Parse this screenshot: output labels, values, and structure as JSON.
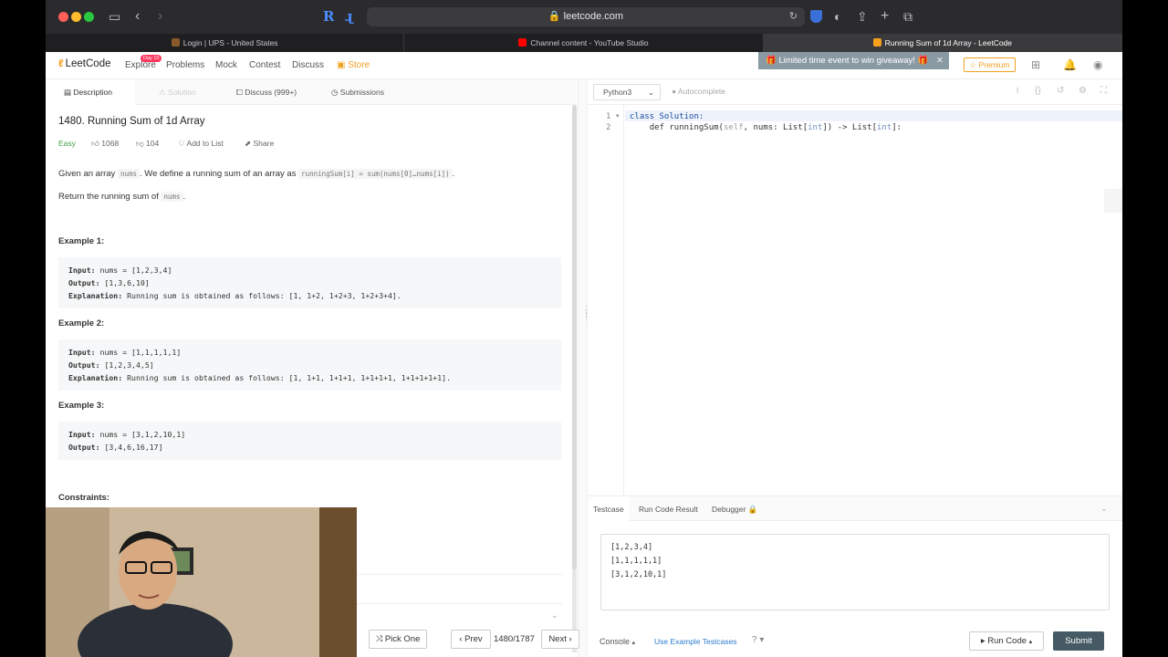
{
  "browser": {
    "url": "leetcode.com",
    "tabs": [
      {
        "title": "Login | UPS - United States",
        "active": false
      },
      {
        "title": "Channel content - YouTube Studio",
        "active": false
      },
      {
        "title": "Running Sum of 1d Array - LeetCode",
        "active": true
      }
    ]
  },
  "nav": {
    "logo": "LeetCode",
    "day_badge": "Day 10",
    "links": [
      "Explore",
      "Problems",
      "Mock",
      "Contest",
      "Discuss",
      "Store"
    ],
    "giveaway": "Limited time event to win giveaway!",
    "premium": "Premium"
  },
  "left_tabs": [
    "Description",
    "Solution",
    "Discuss (999+)",
    "Submissions"
  ],
  "problem": {
    "title": "1480. Running Sum of 1d Array",
    "difficulty": "Easy",
    "likes": "1068",
    "dislikes": "104",
    "add_to_list": "Add to List",
    "share": "Share",
    "desc_pre": "Given an array",
    "desc_code1": "nums",
    "desc_mid": ". We define a running sum of an array as",
    "desc_code2": "runningSum[i] = sum(nums[0]…nums[i])",
    "desc_end": ".",
    "return_pre": "Return the running sum of",
    "return_code": "nums",
    "return_end": ".",
    "examples": [
      {
        "heading": "Example 1:",
        "input": "nums = [1,2,3,4]",
        "output": "[1,3,6,10]",
        "explanation": "Running sum is obtained as follows: [1, 1+2, 1+2+3, 1+2+3+4]."
      },
      {
        "heading": "Example 2:",
        "input": "nums = [1,1,1,1,1]",
        "output": "[1,2,3,4,5]",
        "explanation": "Running sum is obtained as follows: [1, 1+1, 1+1+1, 1+1+1+1, 1+1+1+1+1]."
      },
      {
        "heading": "Example 3:",
        "input": "nums = [3,1,2,10,1]",
        "output": "[3,4,6,16,17]",
        "explanation": ""
      }
    ],
    "labels": {
      "input": "Input:",
      "output": "Output:",
      "explanation": "Explanation:"
    },
    "constraints": "Constraints:"
  },
  "left_bottom": {
    "pick_one": "Pick One",
    "prev": "Prev",
    "page": "1480/1787",
    "next": "Next"
  },
  "editor": {
    "language": "Python3",
    "autocomplete": "Autocomplete",
    "line_numbers": [
      "1",
      "2"
    ],
    "line1": {
      "kw": "class",
      "name": "Solution:"
    },
    "line2": {
      "kw": "def",
      "fn": "runningSum(",
      "self": "self",
      "rest1": ", nums: List[",
      "t1": "int",
      "rest2": "]) -> List[",
      "t2": "int",
      "rest3": "]:"
    }
  },
  "console_tabs": [
    "Testcase",
    "Run Code Result",
    "Debugger"
  ],
  "testcase": "[1,2,3,4]\n[1,1,1,1,1]\n[3,1,2,10,1]",
  "editor_bottom": {
    "console": "Console",
    "examples": "Use Example Testcases",
    "run": "Run Code",
    "submit": "Submit"
  }
}
